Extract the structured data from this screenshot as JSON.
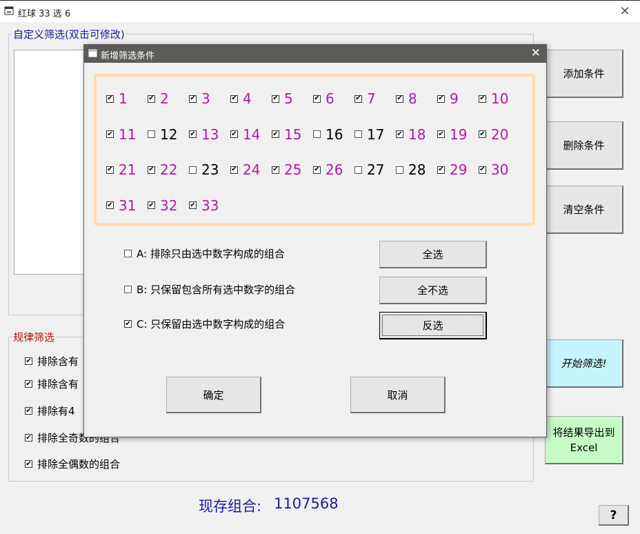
{
  "window": {
    "title": "红球 33 选 6",
    "close_glyph": "✕"
  },
  "custom_filter": {
    "legend": "自定义筛选(双击可修改)"
  },
  "rule_filter": {
    "legend": "规律筛选",
    "items": [
      {
        "label": "排除含有",
        "checked": true
      },
      {
        "label": "排除含有",
        "checked": true
      },
      {
        "label": "排除有4",
        "checked": true
      },
      {
        "label": "排除全奇数的组合",
        "checked": true
      },
      {
        "label": "排除全偶数的组合",
        "checked": true
      }
    ]
  },
  "right_buttons": {
    "add": "添加条件",
    "delete": "删除条件",
    "clear": "清空条件",
    "start": "开始筛选!",
    "export": "将结果导出到\nExcel",
    "help": "?"
  },
  "status": {
    "label": "现存组合:",
    "value": "1107568"
  },
  "dialog": {
    "title": "新增筛选条件",
    "close_glyph": "✕",
    "numbers": [
      {
        "n": "1",
        "checked": true
      },
      {
        "n": "2",
        "checked": true
      },
      {
        "n": "3",
        "checked": true
      },
      {
        "n": "4",
        "checked": true
      },
      {
        "n": "5",
        "checked": true
      },
      {
        "n": "6",
        "checked": true
      },
      {
        "n": "7",
        "checked": true
      },
      {
        "n": "8",
        "checked": true
      },
      {
        "n": "9",
        "checked": true
      },
      {
        "n": "10",
        "checked": true
      },
      {
        "n": "11",
        "checked": true
      },
      {
        "n": "12",
        "checked": false
      },
      {
        "n": "13",
        "checked": true
      },
      {
        "n": "14",
        "checked": true
      },
      {
        "n": "15",
        "checked": true
      },
      {
        "n": "16",
        "checked": false
      },
      {
        "n": "17",
        "checked": false
      },
      {
        "n": "18",
        "checked": true
      },
      {
        "n": "19",
        "checked": true
      },
      {
        "n": "20",
        "checked": true
      },
      {
        "n": "21",
        "checked": true
      },
      {
        "n": "22",
        "checked": true
      },
      {
        "n": "23",
        "checked": false
      },
      {
        "n": "24",
        "checked": true
      },
      {
        "n": "25",
        "checked": true
      },
      {
        "n": "26",
        "checked": true
      },
      {
        "n": "27",
        "checked": false
      },
      {
        "n": "28",
        "checked": false
      },
      {
        "n": "29",
        "checked": true
      },
      {
        "n": "30",
        "checked": true
      },
      {
        "n": "31",
        "checked": true
      },
      {
        "n": "32",
        "checked": true
      },
      {
        "n": "33",
        "checked": true
      }
    ],
    "options": [
      {
        "label": "A: 排除只由选中数字构成的组合",
        "checked": false
      },
      {
        "label": "B: 只保留包含所有选中数字的组合",
        "checked": false
      },
      {
        "label": "C: 只保留由选中数字构成的组合",
        "checked": true
      }
    ],
    "buttons": {
      "select_all": "全选",
      "select_none": "全不选",
      "invert": "反选",
      "ok": "确定",
      "cancel": "取消"
    }
  },
  "colors": {
    "number_checked": "#b01aa4",
    "number_unchecked": "#000000",
    "panel_border": "#ffdcb0",
    "start_button": "#c6f4fb",
    "export_button": "#c6fbc6",
    "legend_custom": "#1a1a9a",
    "legend_rule": "#b01414",
    "status_text": "#1a1a9a"
  },
  "icons": {
    "app": "window-app-icon",
    "close": "close-icon",
    "checkbox": "checkbox-icon"
  }
}
